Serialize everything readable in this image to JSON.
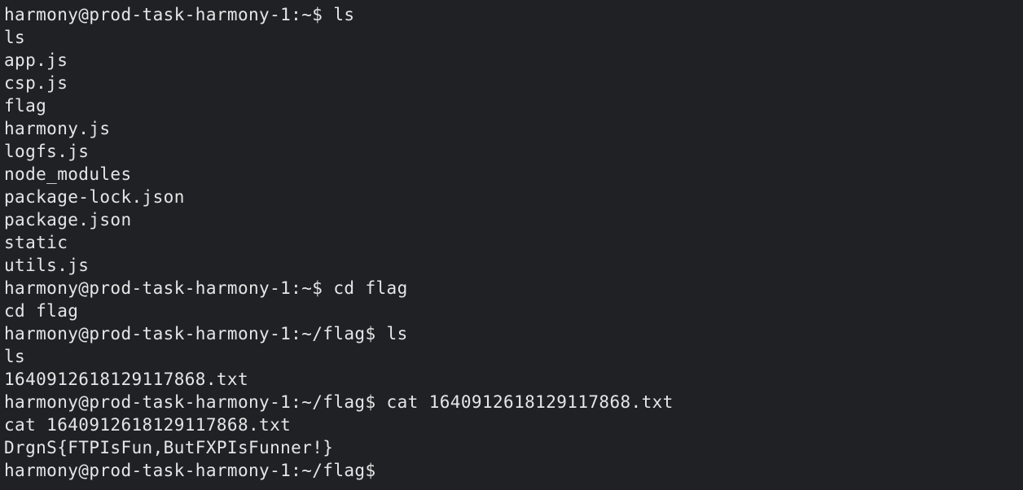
{
  "terminal": {
    "top_cut_text": "harmony@prod-task-harmony-1:~$ ls",
    "lines": [
      "harmony@prod-task-harmony-1:~$ ls",
      "ls",
      "app.js",
      "csp.js",
      "flag",
      "harmony.js",
      "logfs.js",
      "node_modules",
      "package-lock.json",
      "package.json",
      "static",
      "utils.js",
      "harmony@prod-task-harmony-1:~$ cd flag",
      "cd flag",
      "harmony@prod-task-harmony-1:~/flag$ ls",
      "ls",
      "1640912618129117868.txt",
      "harmony@prod-task-harmony-1:~/flag$ cat 1640912618129117868.txt",
      "cat 1640912618129117868.txt",
      "DrgnS{FTPIsFun,ButFXPIsFunner!}",
      "harmony@prod-task-harmony-1:~/flag$"
    ]
  },
  "colors": {
    "background": "#1f2125",
    "foreground": "#e6e6e6"
  }
}
